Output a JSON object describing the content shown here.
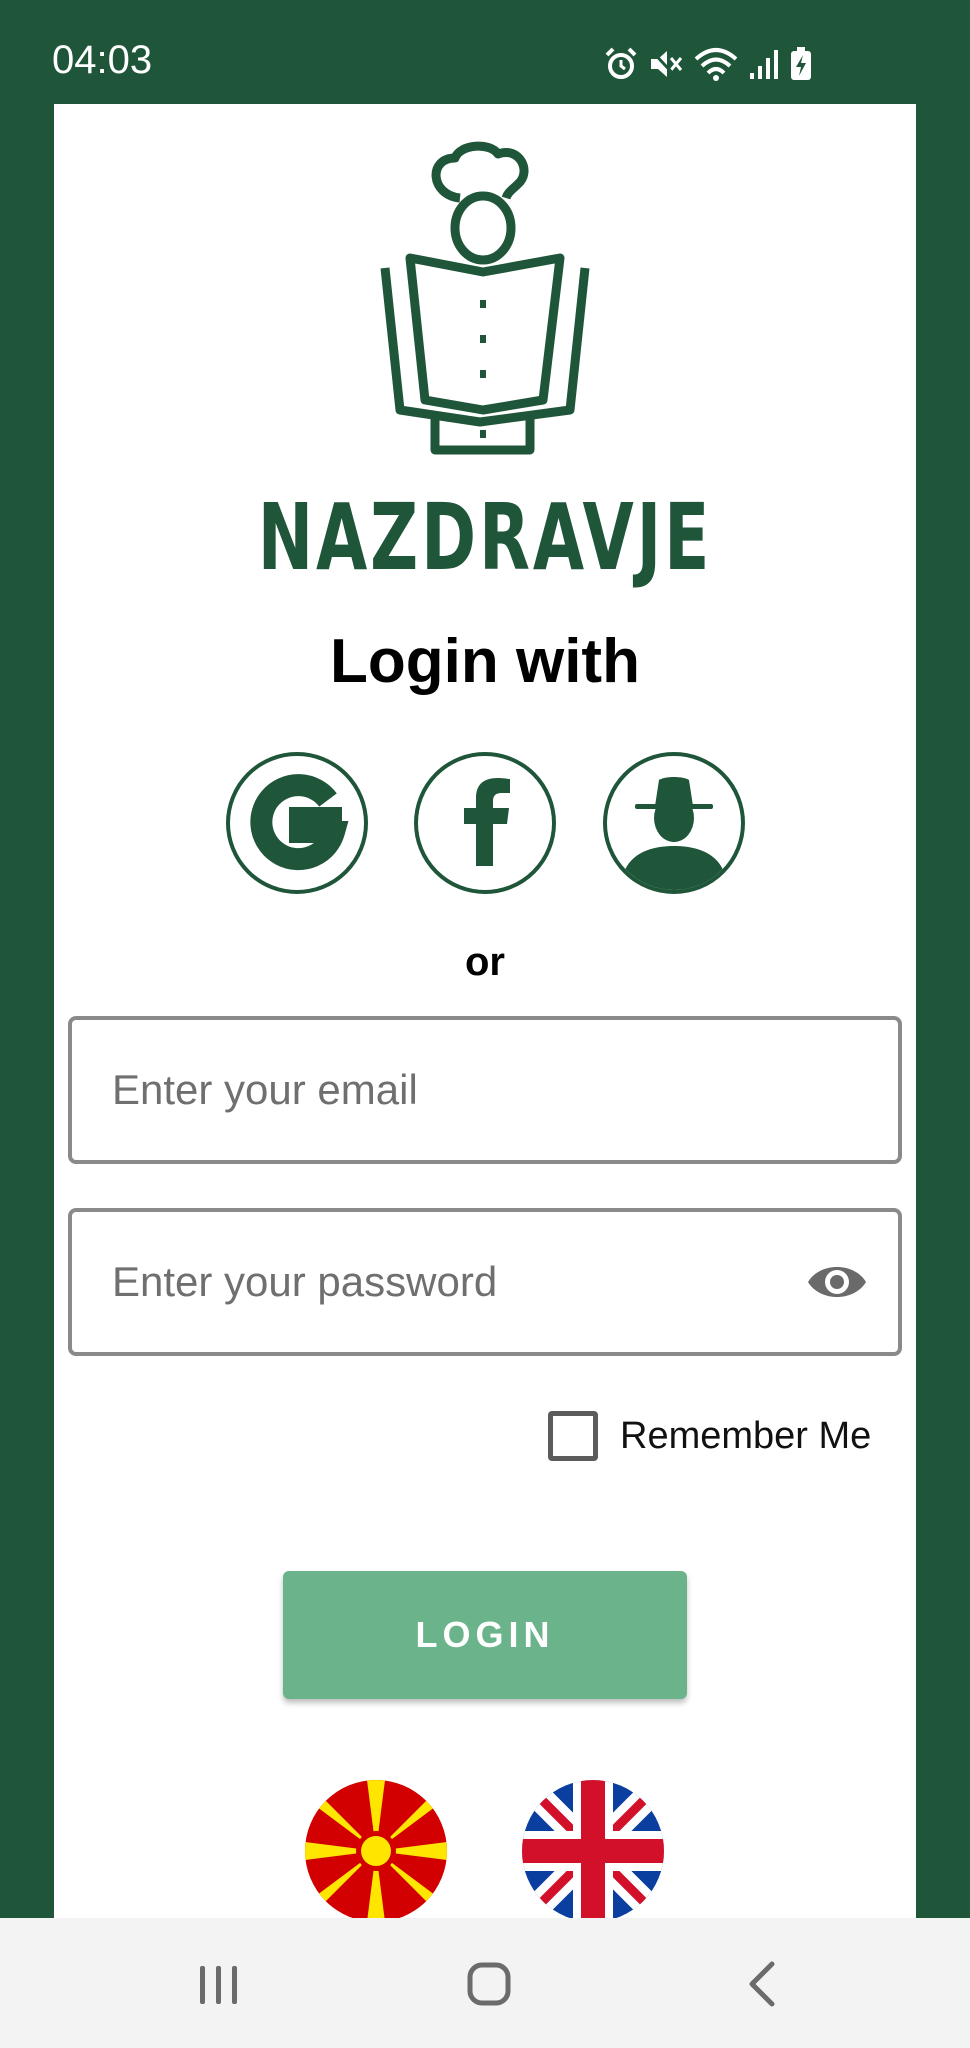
{
  "status_bar": {
    "time": "04:03",
    "icons": [
      "alarm-icon",
      "mute-icon",
      "wifi-icon",
      "signal-icon",
      "battery-charging-icon"
    ]
  },
  "app": {
    "brand_name": "NAZDRAVJE",
    "logo_icon": "chef-book-logo-icon",
    "accent_color": "#1f563a",
    "button_color": "#6bb38a"
  },
  "login": {
    "heading": "Login with",
    "social_buttons": [
      {
        "name": "google",
        "icon": "google-icon"
      },
      {
        "name": "facebook",
        "icon": "facebook-icon"
      },
      {
        "name": "guest",
        "icon": "guest-user-icon"
      }
    ],
    "separator": "or",
    "email_placeholder": "Enter your email",
    "email_value": "",
    "password_placeholder": "Enter your password",
    "password_value": "",
    "remember_me_label": "Remember Me",
    "remember_me_checked": false,
    "login_button_label": "LOGIN"
  },
  "languages": [
    {
      "name": "macedonian",
      "icon": "macedonia-flag-icon"
    },
    {
      "name": "english",
      "icon": "uk-flag-icon"
    }
  ],
  "nav_bar": {
    "buttons": [
      "recents-icon",
      "home-icon",
      "back-icon"
    ]
  }
}
